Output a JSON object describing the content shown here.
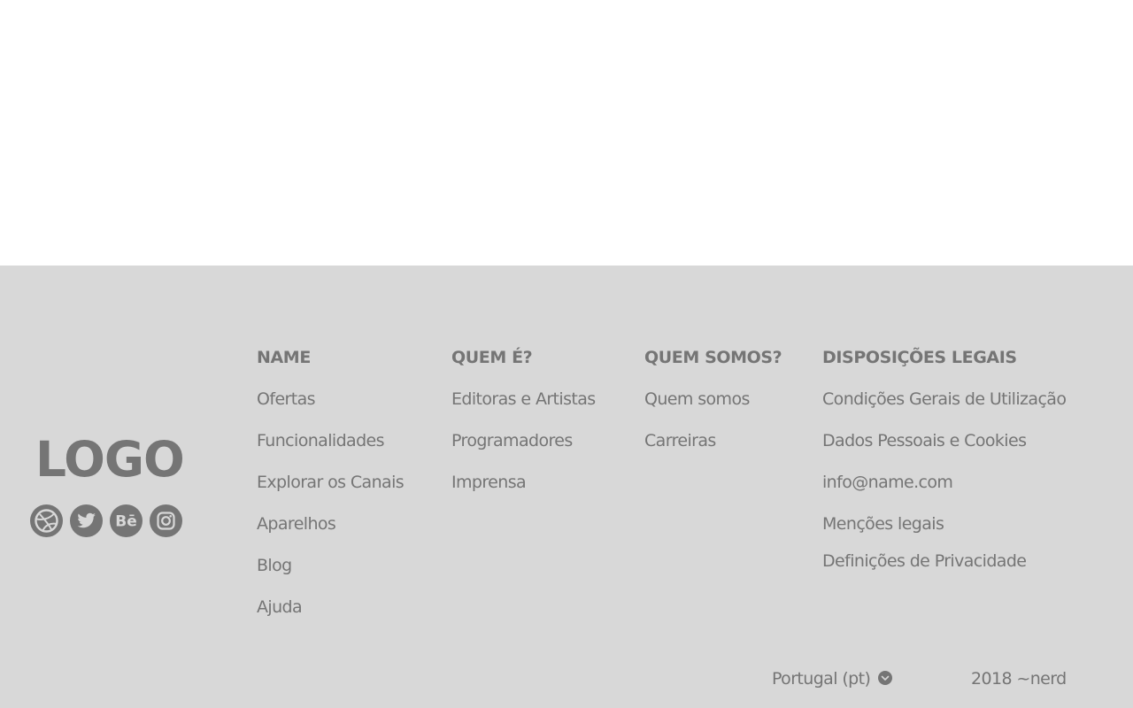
{
  "logo": {
    "text": "LOGO"
  },
  "social": [
    {
      "icon": "dribbble-icon"
    },
    {
      "icon": "twitter-icon"
    },
    {
      "icon": "behance-icon",
      "glyph": "Bē"
    },
    {
      "icon": "instagram-icon"
    }
  ],
  "columns": [
    {
      "heading": "NAME",
      "links": [
        "Ofertas",
        "Funcionalidades",
        "Explorar os Canais",
        "Aparelhos",
        "Blog",
        "Ajuda"
      ]
    },
    {
      "heading": "QUEM É?",
      "links": [
        "Editoras e Artistas",
        "Programadores",
        "Imprensa"
      ]
    },
    {
      "heading": "QUEM SOMOS?",
      "links": [
        "Quem somos",
        "Carreiras"
      ]
    },
    {
      "heading": "DISPOSIÇÕES LEGAIS",
      "links": [
        "Condições Gerais de Utilização",
        "Dados Pessoais e Cookies",
        "info@name.com",
        "Menções legais",
        "Definições de Privacidade"
      ]
    }
  ],
  "language": {
    "label": "Portugal (pt)",
    "icon": "chevron-down-icon"
  },
  "copyright": "2018 ~nerd",
  "colors": {
    "footer_bg": "#d8d8d8",
    "text": "#757575",
    "page_bg": "#ffffff"
  }
}
